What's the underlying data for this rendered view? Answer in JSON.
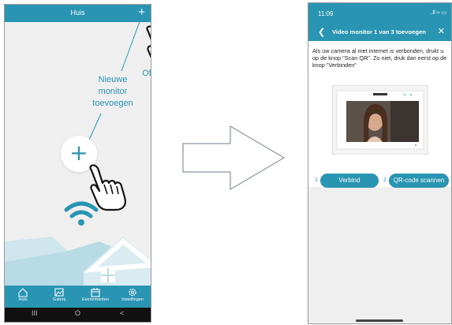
{
  "left_phone": {
    "title": "Huis",
    "add_icon": "plus-icon",
    "annotation_new": "Nieuwe\nmonitor\ntoevoegen",
    "annotation_or": "Of",
    "nav": [
      {
        "label": "Huis",
        "icon": "home-icon"
      },
      {
        "label": "Galerij",
        "icon": "gallery-icon"
      },
      {
        "label": "Evenementen",
        "icon": "calendar-icon"
      },
      {
        "label": "Instellingen",
        "icon": "gear-icon"
      }
    ],
    "system_nav": [
      "III",
      "O",
      "<"
    ]
  },
  "right_phone": {
    "status_time": "11:09",
    "status_icons": "..ll  ≈  ▭",
    "header_title": "Video monitor 1 van 3 toevoegen",
    "instruction": "Als uw camera al met internet is verbonden, drukt u op de knop \"Scan QR\". Zo niet, druk dan eerst op de knop \"Verbinden\"",
    "step1_num": "1",
    "step1_label": "Verbind",
    "step2_num": "2",
    "step2_label": "QR-code scannen"
  },
  "colors": {
    "accent": "#2a94b3",
    "background": "#efeff0"
  }
}
